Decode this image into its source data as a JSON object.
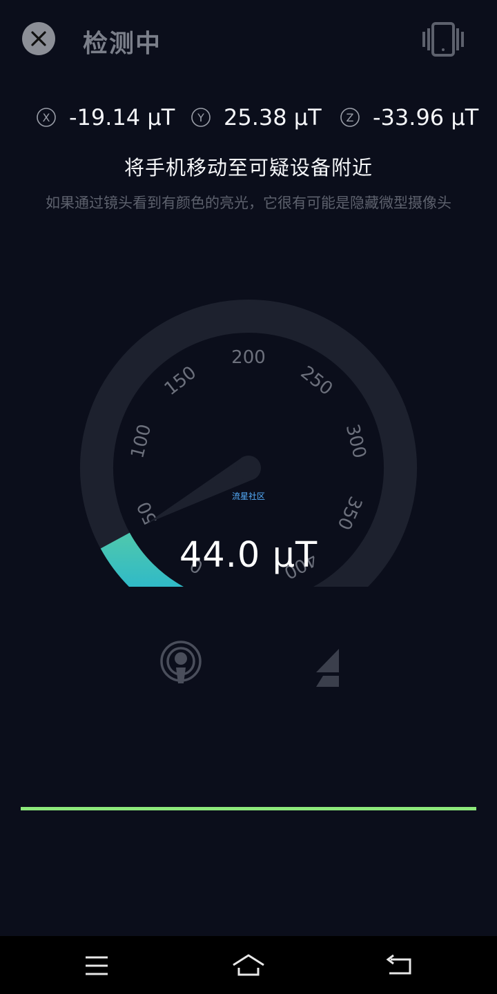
{
  "header": {
    "title": "检测中",
    "close_icon": "close-icon",
    "vibrate_icon": "vibrate-phone-icon"
  },
  "axes": [
    {
      "badge": "X",
      "value": "-19.14 μT"
    },
    {
      "badge": "Y",
      "value": "25.38 μT"
    },
    {
      "badge": "Z",
      "value": "-33.96 μT"
    }
  ],
  "instruction": "将手机移动至可疑设备附近",
  "hint": "如果通过镜头看到有颜色的亮光，它很有可能是隐藏微型摄像头",
  "gauge": {
    "min": 0,
    "max": 400,
    "value": 44.0,
    "ticks": [
      "0",
      "50",
      "100",
      "150",
      "200",
      "250",
      "300",
      "350",
      "400"
    ],
    "watermark": "流星社区",
    "reading": "44.0 μT",
    "colors": {
      "track": "#1d212e",
      "fill_start": "#4bc6b0",
      "fill_end": "#27b6cf",
      "needle": "#1d212e",
      "tick_label": "#6c707c"
    }
  },
  "modes": [
    {
      "icon": "signal-detector-icon",
      "active": true
    },
    {
      "icon": "lightning-icon",
      "active": false
    }
  ],
  "progress": {
    "fraction": 1.0,
    "color": "#8de87b"
  },
  "navbar": {
    "icons": [
      "menu-icon",
      "home-icon",
      "back-icon"
    ]
  }
}
